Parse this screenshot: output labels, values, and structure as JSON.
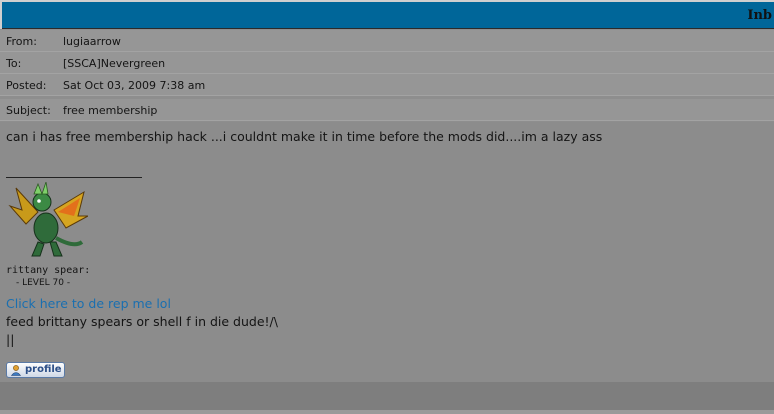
{
  "header": {
    "title": "Inb"
  },
  "message": {
    "from_label": "From:",
    "from_value": "lugiaarrow",
    "to_label": "To:",
    "to_value": "[SSCA]Nevergreen",
    "posted_label": "Posted:",
    "posted_value": "Sat Oct 03, 2009 7:38 am",
    "subject_label": "Subject:",
    "subject_value": "free membership",
    "body": "can i has free membership hack ...i couldnt make it in time before the mods did....im a lazy ass"
  },
  "signature": {
    "avatar_icon": "dragon-avatar-icon",
    "name": "rittany spear:",
    "level": "- LEVEL 70 -",
    "link_text": "Click here to de rep me lol",
    "line1": "feed brittany spears or shell f in die dude!/\\",
    "line2": "||"
  },
  "actions": {
    "profile_label": "profile",
    "profile_icon": "user-icon"
  },
  "colors": {
    "header_bar": "#006699",
    "link": "#1a6fb0"
  }
}
